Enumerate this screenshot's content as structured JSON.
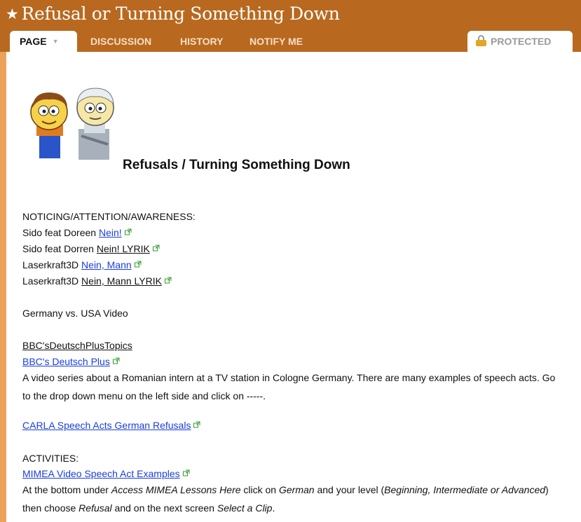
{
  "header": {
    "title": "Refusal or Turning Something Down",
    "star": "★",
    "tabs": {
      "page": "PAGE",
      "discussion": "DISCUSSION",
      "history": "HISTORY",
      "notify": "NOTIFY ME",
      "protected": "PROTECTED"
    }
  },
  "content": {
    "heading": "Refusals / Turning Something Down",
    "noticing_label": "NOTICING/ATTENTION/AWARENESS:",
    "songs": [
      {
        "artist": "Sido feat Doreen",
        "link": "Nein!"
      },
      {
        "artist": "Sido feat Dorren",
        "link": "Nein! LYRIK"
      },
      {
        "artist": "Laserkraft3D",
        "link": "Nein, Mann"
      },
      {
        "artist": "Laserkraft3D",
        "link": "Nein, Mann LYRIK"
      }
    ],
    "germany_usa": "Germany vs. USA Video",
    "bbc_topics": "BBC'sDeutschPlusTopics",
    "bbc_plus": "BBC's Deutsch Plus",
    "bbc_description": "A video series about a Romanian intern at a TV station in Cologne Germany. There are many examples of speech acts. Go to the drop down menu on the left side and click on -----.",
    "carla": "CARLA Speech Acts German Refusals",
    "activities_label": "ACTIVITIES:",
    "mimea": "MIMEA Video Speech Act Examples",
    "instructions": {
      "p1": "At the bottom under ",
      "i1": "Access MIMEA Lessons Here",
      "p2": " click on ",
      "i2": "German",
      "p3": " and your level (",
      "i3": "Beginning, Intermediate or Advanced",
      "p4": ") then choose ",
      "i4": "Refusal",
      "p5": " and on the next screen ",
      "i5": "Select a Clip",
      "p6": "."
    }
  },
  "colors": {
    "header_bg": "#b8691f",
    "sidebar": "#eca25a",
    "link": "#1a3de0"
  }
}
